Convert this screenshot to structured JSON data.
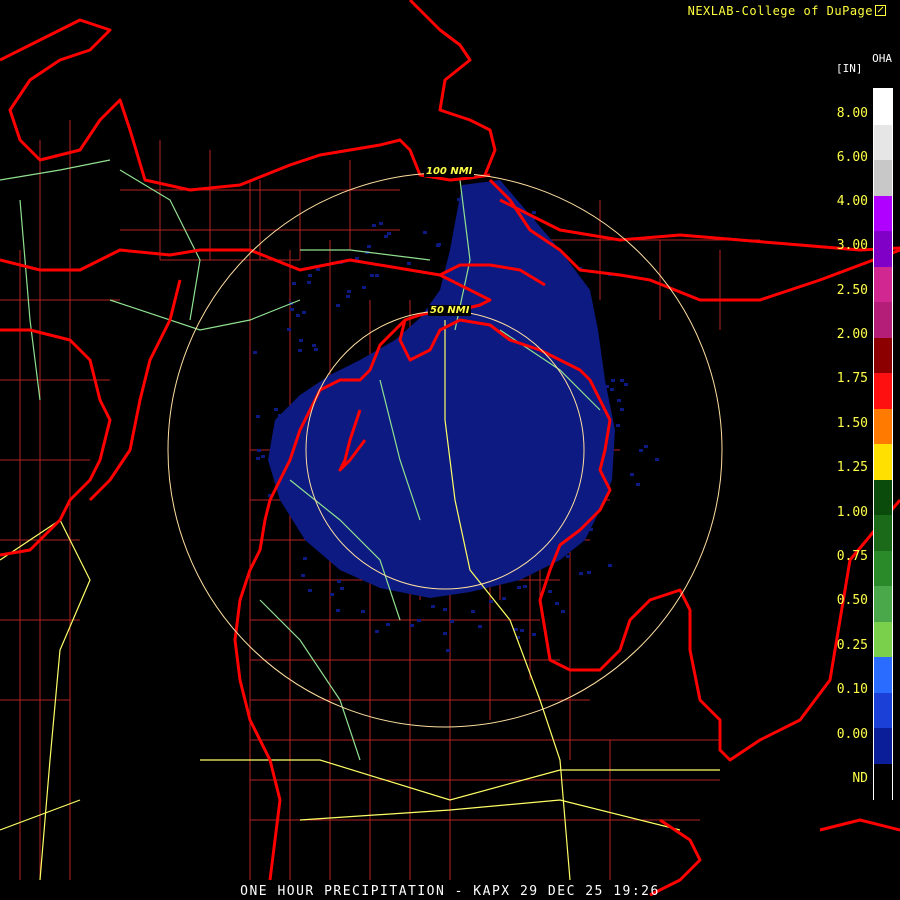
{
  "credit": "NEXLAB-College of DuPage",
  "product_code": "OHA",
  "unit_label": "[IN]",
  "title": "ONE HOUR PRECIPITATION - KAPX 29 DEC 25 19:26",
  "range_rings": {
    "inner": "50 NMI",
    "outer": "100 NMI"
  },
  "legend": {
    "labels": [
      "8.00",
      "6.00",
      "4.00",
      "3.00",
      "2.50",
      "2.00",
      "1.75",
      "1.50",
      "1.25",
      "1.00",
      "0.75",
      "0.50",
      "0.25",
      "0.10",
      "0.00",
      "ND"
    ],
    "colors": [
      "#ffffff",
      "#e6e6e6",
      "#c8c8c8",
      "#b000ff",
      "#8000c8",
      "#d02890",
      "#b41e78",
      "#8c0000",
      "#ff1010",
      "#ff7a00",
      "#ffe000",
      "#0a4a0a",
      "#1a6a1a",
      "#2a8a2a",
      "#4aa84a",
      "#7ad04a",
      "#2a6cff",
      "#1a40d8",
      "#0a1e9a",
      "#000000"
    ]
  },
  "colors": {
    "border": "#ff0000",
    "county": "#b22222",
    "interstate": "#ffff66",
    "highway": "#90e090",
    "ring": "#ffdfa0",
    "echo": "#0c1a82"
  }
}
